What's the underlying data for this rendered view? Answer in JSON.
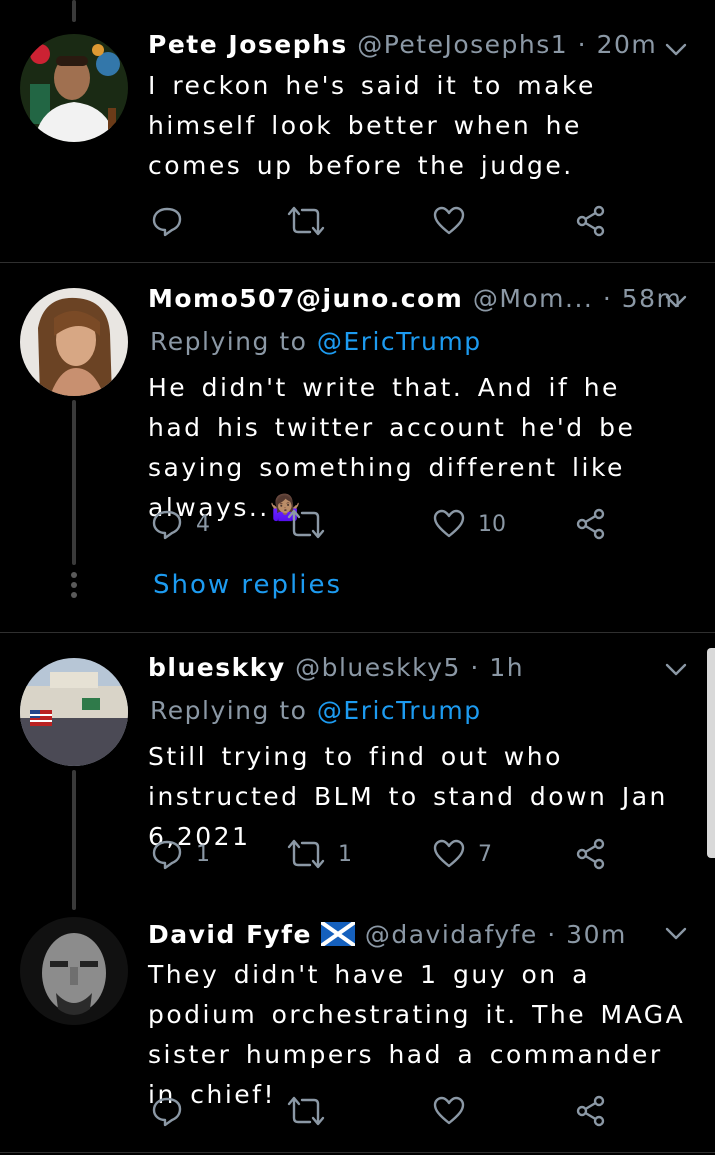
{
  "tweets": [
    {
      "name": "Pete Josephs",
      "handle": "@PeteJosephs1",
      "time": "20m",
      "replying_prefix": "",
      "replying_to": "",
      "text": "I reckon he's said it to make himself look better when he comes up before the judge.",
      "replies": "",
      "retweets": "",
      "likes": ""
    },
    {
      "name": "Momo507@juno.com",
      "handle": "@Mom...",
      "time": "58m",
      "replying_prefix": "Replying to",
      "replying_to": "@EricTrump",
      "text": "He didn't write that. And if he had his twitter account he'd be saying something different like always..🤷🏽‍♀️",
      "replies": "4",
      "retweets": "",
      "likes": "10",
      "show_replies": "Show replies"
    },
    {
      "name": "blueskky",
      "handle": "@blueskky5",
      "time": "1h",
      "replying_prefix": "Replying to",
      "replying_to": "@EricTrump",
      "text": "Still trying to find out who instructed BLM to stand down Jan 6,2021",
      "replies": "1",
      "retweets": "1",
      "likes": "7"
    },
    {
      "name": "David Fyfe",
      "handle": "@davidafyfe",
      "time": "30m",
      "replying_prefix": "",
      "replying_to": "",
      "text": "They didn't have 1 guy on a podium orchestrating it. The MAGA sister humpers had a commander in chief!",
      "replies": "",
      "retweets": "",
      "likes": ""
    }
  ],
  "separator": "·",
  "colors": {
    "background": "#000000",
    "secondary": "#8b98a5",
    "accent": "#1d9bf0"
  },
  "icons": [
    "reply-icon",
    "retweet-icon",
    "like-icon",
    "share-icon",
    "chevron-down-icon",
    "scotland-flag-icon"
  ]
}
